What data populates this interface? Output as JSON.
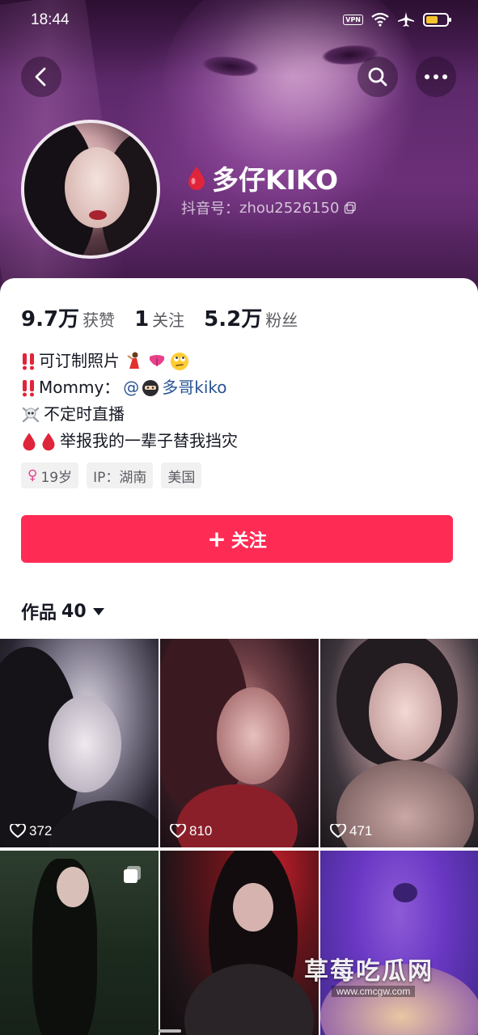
{
  "status_bar": {
    "time": "18:44",
    "vpn": "VPN"
  },
  "header": {
    "back_icon": "chevron-left-icon",
    "search_icon": "search-icon",
    "more_icon": "more-dots-icon"
  },
  "profile": {
    "name": "多仔KIKO",
    "id_label": "抖音号：",
    "id_value": "zhou2526150"
  },
  "stats": [
    {
      "value": "9.7万",
      "label": "获赞"
    },
    {
      "value": "1",
      "label": "关注"
    },
    {
      "value": "5.2万",
      "label": "粉丝"
    }
  ],
  "bio": {
    "line1": "可订制照片",
    "line2_prefix": "Mommy：",
    "line2_mention_at": "@",
    "line2_mention_name": "多哥kiko",
    "line3": "不定时直播",
    "line4": "举报我的一辈子替我挡灾"
  },
  "tags": {
    "age": "19岁",
    "ip": "IP：湖南",
    "country": "美国"
  },
  "follow_button": {
    "label": "关注",
    "plus": "+"
  },
  "works": {
    "label": "作品",
    "count": "40"
  },
  "videos": [
    {
      "likes": "372"
    },
    {
      "likes": "810"
    },
    {
      "likes": "471"
    }
  ],
  "watermark": {
    "title": "草莓吃瓜网",
    "url": "www.cmcgw.com"
  },
  "colors": {
    "accent": "#fe2c55",
    "mention": "#2a5494",
    "drop": "#e0243a"
  }
}
